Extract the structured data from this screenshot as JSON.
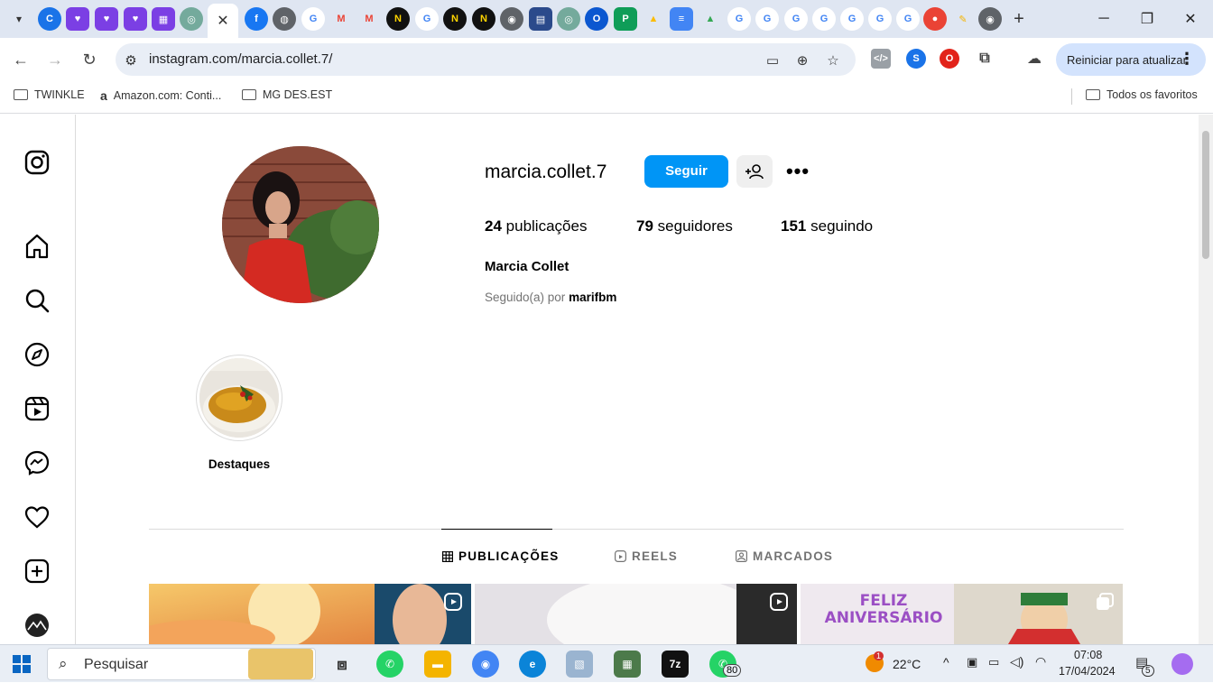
{
  "browser": {
    "tabs": [
      "facebook",
      "globe",
      "google",
      "gmail",
      "gmail",
      "notion",
      "google",
      "notion",
      "notion",
      "chrome",
      "forms",
      "chatgpt",
      "opera",
      "sheets",
      "drive",
      "docs",
      "drive",
      "google",
      "google",
      "google",
      "google",
      "google",
      "google",
      "google"
    ],
    "active_tab_close": "✕",
    "new_tab": "+",
    "url": "instagram.com/marcia.collet.7/",
    "restart_label": "Reiniciar para atualizar",
    "bookmarks": [
      {
        "label": "TWINKLE",
        "icon": "folder-icon"
      },
      {
        "label": "Amazon.com: Conti...",
        "icon": "amazon-icon"
      },
      {
        "label": "MG DES.EST",
        "icon": "folder-icon"
      }
    ],
    "all_bookmarks": "Todos os favoritos"
  },
  "profile": {
    "username": "marcia.collet.7",
    "follow_label": "Seguir",
    "posts_count": "24",
    "posts_label": "publicações",
    "followers_count": "79",
    "followers_label": "seguidores",
    "following_count": "151",
    "following_label": "seguindo",
    "full_name": "Marcia Collet",
    "followed_by_prefix": "Seguido(a) por",
    "followed_by_user": "marifbm",
    "highlight_label": "Destaques"
  },
  "post_tabs": [
    {
      "label": "PUBLICAÇÕES",
      "active": true
    },
    {
      "label": "REELS",
      "active": false
    },
    {
      "label": "MARCADOS",
      "active": false
    }
  ],
  "posts": [
    {
      "badge": "reel-icon"
    },
    {
      "badge": "reel-icon"
    },
    {
      "badge": "carousel-icon",
      "overlay_text": "FELIZ ANIVERSÁRIO"
    }
  ],
  "taskbar": {
    "search_placeholder": "Pesquisar",
    "whatsapp_badge": "80",
    "weather_badge": "1",
    "temperature": "22°C",
    "time": "07:08",
    "date": "17/04/2024",
    "notifications": "5"
  },
  "colors": {
    "accent": "#0095f6",
    "tabbar": "#dfe6f2",
    "omnibox": "#e9eef6"
  }
}
